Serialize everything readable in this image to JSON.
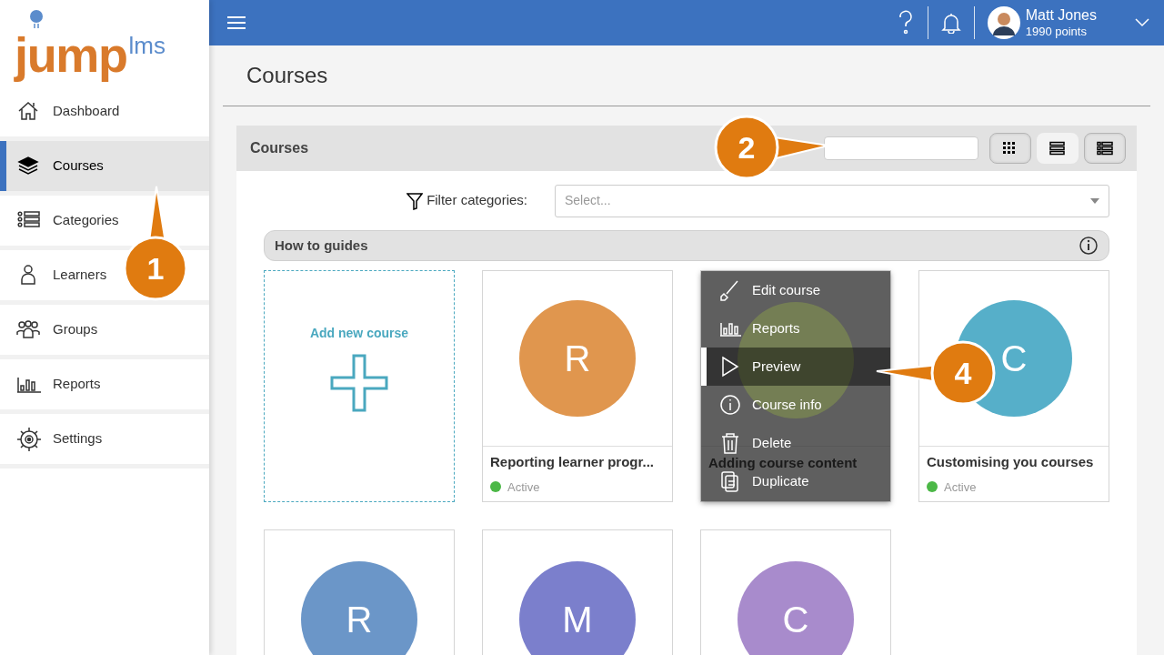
{
  "logo": {
    "main": "jump",
    "sub": "lms"
  },
  "sidebar": {
    "items": [
      {
        "label": "Dashboard",
        "selected": false
      },
      {
        "label": "Courses",
        "selected": true
      },
      {
        "label": "Categories",
        "selected": false
      },
      {
        "label": "Learners",
        "selected": false
      },
      {
        "label": "Groups",
        "selected": false
      },
      {
        "label": "Reports",
        "selected": false
      },
      {
        "label": "Settings",
        "selected": false
      }
    ]
  },
  "header": {
    "user": {
      "name": "Matt Jones",
      "points": "1990 points"
    }
  },
  "page_title": "Courses",
  "panel": {
    "title": "Courses",
    "view_buttons": [
      {
        "selected": false
      },
      {
        "selected": true
      },
      {
        "selected": false
      }
    ],
    "filter": {
      "label": "Filter categories:",
      "placeholder": "Select..."
    },
    "category": "How to guides",
    "add_course": "Add new course",
    "courses": [
      {
        "letter": "R",
        "color": "#e0964e",
        "title": "Reporting learner progr...",
        "status": "Active"
      },
      {
        "title": "Adding course content",
        "menu_open": true
      },
      {
        "letter": "C",
        "color": "#56afc9",
        "title": "Customising you courses",
        "status": "Active"
      },
      {
        "letter": "R",
        "color": "#6b96c8"
      },
      {
        "letter": "M",
        "color": "#7b7fcc"
      },
      {
        "letter": "C",
        "color": "#a88bcc"
      }
    ],
    "menu": [
      {
        "label": "Edit course",
        "selected": false
      },
      {
        "label": "Reports",
        "selected": false
      },
      {
        "label": "Preview",
        "selected": true
      },
      {
        "label": "Course info",
        "selected": false
      },
      {
        "label": "Delete",
        "selected": false
      },
      {
        "label": "Duplicate",
        "selected": false
      }
    ]
  },
  "callouts": [
    "1",
    "2",
    "4"
  ]
}
